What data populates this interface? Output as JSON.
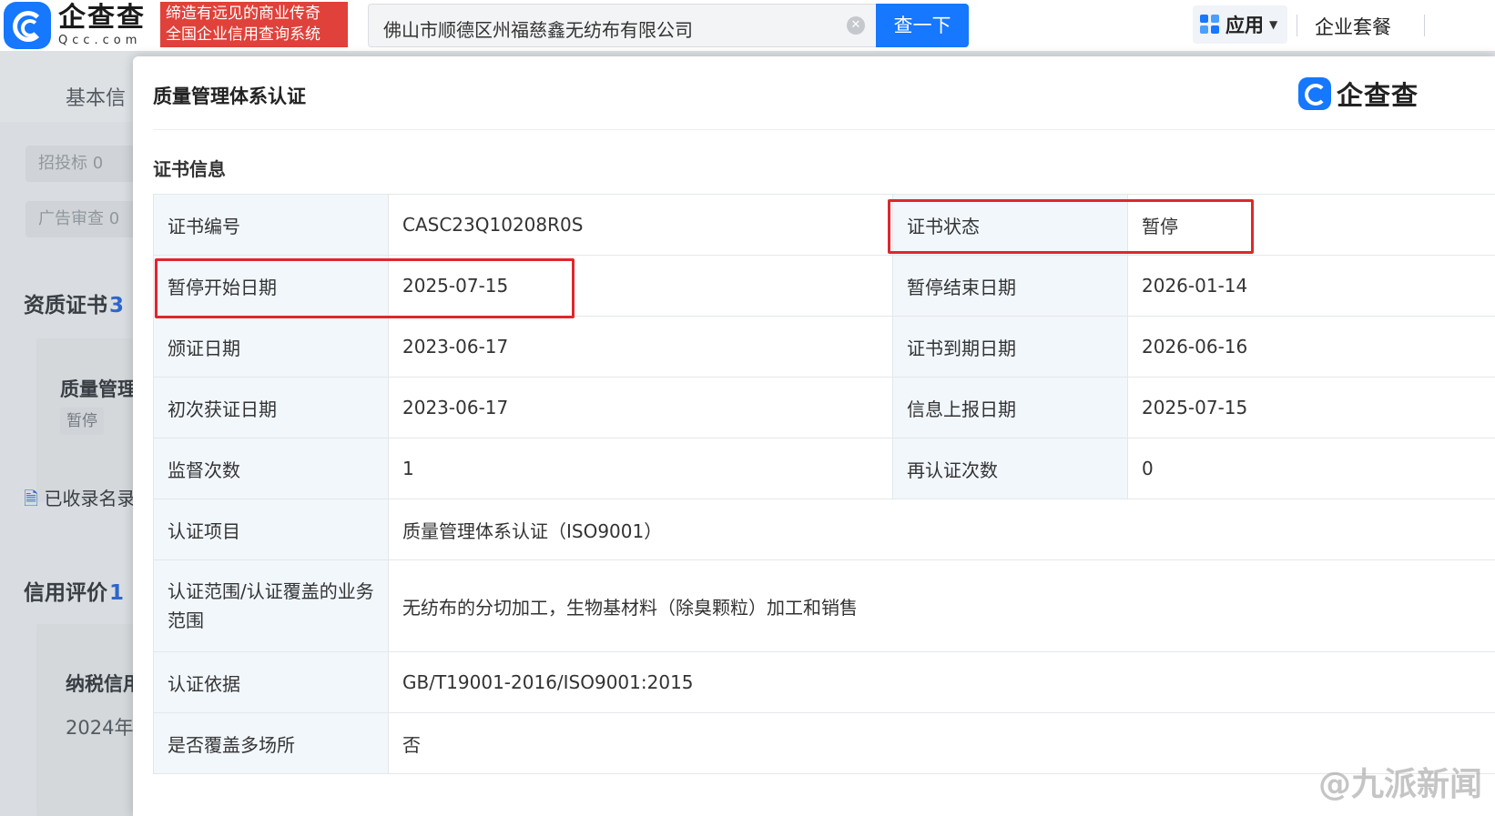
{
  "header": {
    "logo_cn": "企查查",
    "logo_en": "Qcc.com",
    "slogan_line1": "缔造有远见的商业传奇",
    "slogan_line2": "全国企业信用查询系统",
    "search_value": "佛山市顺德区州福慈鑫无纺布有限公司",
    "search_button": "查一下",
    "apps_label": "应用",
    "package_link": "企业套餐"
  },
  "background": {
    "tab_basic": "基本信",
    "pill_bidding": "招投标 0",
    "pill_ad_review": "广告审查 0",
    "qualification_heading": "资质证书",
    "qualification_count": "3",
    "qm_title": "质量管理",
    "qm_status": "暂停",
    "collected_note": "已收录名录",
    "credit_heading": "信用评价",
    "credit_count": "1",
    "tax_title": "纳税信用",
    "tax_year": "2024年"
  },
  "modal": {
    "title": "质量管理体系认证",
    "logo_text": "企查查",
    "section_title": "证书信息",
    "rows": [
      {
        "k1": "证书编号",
        "v1": "CASC23Q10208R0S",
        "k2": "证书状态",
        "v2": "暂停"
      },
      {
        "k1": "暂停开始日期",
        "v1": "2025-07-15",
        "k2": "暂停结束日期",
        "v2": "2026-01-14"
      },
      {
        "k1": "颁证日期",
        "v1": "2023-06-17",
        "k2": "证书到期日期",
        "v2": "2026-06-16"
      },
      {
        "k1": "初次获证日期",
        "v1": "2023-06-17",
        "k2": "信息上报日期",
        "v2": "2025-07-15"
      },
      {
        "k1": "监督次数",
        "v1": "1",
        "k2": "再认证次数",
        "v2": "0"
      }
    ],
    "wide_rows": [
      {
        "k": "认证项目",
        "v": "质量管理体系认证（ISO9001）"
      },
      {
        "k": "认证范围/认证覆盖的业务范围",
        "v": "无纺布的分切加工，生物基材料（除臭颗粒）加工和销售"
      },
      {
        "k": "认证依据",
        "v": "GB/T19001-2016/ISO9001:2015"
      },
      {
        "k": "是否覆盖多场所",
        "v": "否"
      }
    ]
  },
  "watermark": "@九派新闻",
  "colors": {
    "accent": "#1677ff",
    "highlight": "#e0262d",
    "slogan_bg": "#e0413a",
    "key_cell_bg": "#f2f7fc"
  }
}
